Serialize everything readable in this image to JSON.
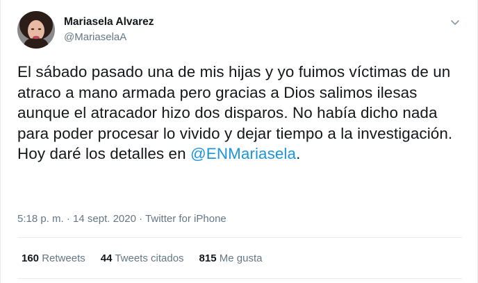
{
  "author": {
    "display_name": "Mariasela Alvarez",
    "handle": "@MariaselaA"
  },
  "tweet": {
    "text": "El sábado pasado una de mis hijas y yo fuimos víctimas de un atraco a mano armada pero gracias a Dios salimos ilesas aunque el atracador hizo dos disparos. No había dicho nada para poder procesar lo vivido y dejar tiempo a la investigación. Hoy daré los detalles en",
    "mention": "@ENMariasela",
    "mention_suffix": "."
  },
  "meta": {
    "time": "5:18 p. m.",
    "separator": "·",
    "date": "14 sept. 2020",
    "source": "Twitter for iPhone"
  },
  "stats": {
    "retweets_count": "160",
    "retweets_label": "Retweets",
    "quotes_count": "44",
    "quotes_label": "Tweets citados",
    "likes_count": "815",
    "likes_label": "Me gusta"
  },
  "colors": {
    "link": "#1b95e0",
    "secondary_text": "#657786",
    "primary_text": "#14171a",
    "divider": "#e6ecf0"
  },
  "icons": {
    "menu": "chevron-down-icon"
  }
}
